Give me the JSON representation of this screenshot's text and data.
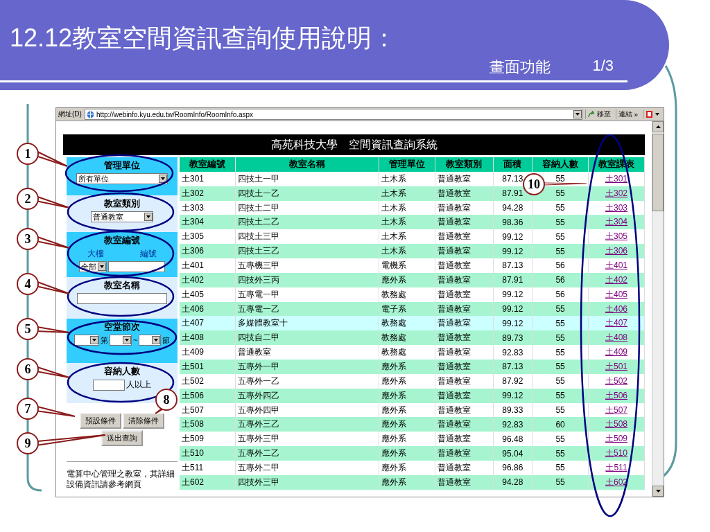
{
  "slide": {
    "title": "12.12教室空間資訊查詢使用說明：",
    "subtitle": "畫面功能",
    "page": "1/3"
  },
  "browser": {
    "address_label": "網址(D)",
    "url": "http://webinfo.kyu.edu.tw/RoomInfo/RoomInfo.aspx",
    "go": "移至",
    "links": "連結",
    "more": "»"
  },
  "page": {
    "header": "高苑科技大學　空間資訊查詢系統",
    "filters": [
      {
        "kind": "dropdown",
        "label": "管理單位",
        "value": "所有單位",
        "wide": true
      },
      {
        "kind": "dropdown",
        "label": "教室類別",
        "value": "普通教室",
        "wide": false
      },
      {
        "kind": "building",
        "label": "教室編號",
        "sublabels": [
          "大樓",
          "編號"
        ],
        "value": "全部"
      },
      {
        "kind": "text",
        "label": "教室名稱"
      },
      {
        "kind": "period",
        "label": "空堂節次",
        "from_text": "第",
        "to_text": "~",
        "end_text": "節"
      },
      {
        "kind": "count",
        "label": "容納人數",
        "suffix": "人以上"
      }
    ],
    "buttons": [
      "預設條件",
      "清除條件"
    ],
    "submit": "送出查詢",
    "note": "電算中心管理之教室，其詳細設備資訊請參考網頁",
    "table": {
      "columns": [
        "教室編號",
        "教室名稱",
        "管理單位",
        "教室類別",
        "面積",
        "容納人數",
        "教室課表"
      ],
      "rows": [
        {
          "code": "土301",
          "name": "四技土一甲",
          "unit": "土木系",
          "type": "普通教室",
          "area": "87.13",
          "capacity": "55",
          "schedule": "土301",
          "highlighted": false
        },
        {
          "code": "土302",
          "name": "四技土一乙",
          "unit": "土木系",
          "type": "普通教室",
          "area": "87.91",
          "capacity": "55",
          "schedule": "土302",
          "highlighted": false
        },
        {
          "code": "土303",
          "name": "四技土二甲",
          "unit": "土木系",
          "type": "普通教室",
          "area": "94.28",
          "capacity": "55",
          "schedule": "土303",
          "highlighted": false
        },
        {
          "code": "土304",
          "name": "四技土二乙",
          "unit": "土木系",
          "type": "普通教室",
          "area": "98.36",
          "capacity": "55",
          "schedule": "土304",
          "highlighted": false
        },
        {
          "code": "土305",
          "name": "四技土三甲",
          "unit": "土木系",
          "type": "普通教室",
          "area": "99.12",
          "capacity": "55",
          "schedule": "土305",
          "highlighted": false
        },
        {
          "code": "土306",
          "name": "四技土三乙",
          "unit": "土木系",
          "type": "普通教室",
          "area": "99.12",
          "capacity": "55",
          "schedule": "土306",
          "highlighted": false
        },
        {
          "code": "土401",
          "name": "五專機三甲",
          "unit": "電機系",
          "type": "普通教室",
          "area": "87.13",
          "capacity": "56",
          "schedule": "土401",
          "highlighted": false
        },
        {
          "code": "土402",
          "name": "四技外三丙",
          "unit": "應外系",
          "type": "普通教室",
          "area": "87.91",
          "capacity": "56",
          "schedule": "土402",
          "highlighted": false
        },
        {
          "code": "土405",
          "name": "五專電一甲",
          "unit": "教務處",
          "type": "普通教室",
          "area": "99.12",
          "capacity": "56",
          "schedule": "土405",
          "highlighted": false
        },
        {
          "code": "土406",
          "name": "五專電一乙",
          "unit": "電子系",
          "type": "普通教室",
          "area": "99.12",
          "capacity": "55",
          "schedule": "土406",
          "highlighted": false
        },
        {
          "code": "土407",
          "name": "多媒體教室十",
          "unit": "教務處",
          "type": "普通教室",
          "area": "99.12",
          "capacity": "55",
          "schedule": "土407",
          "highlighted": true
        },
        {
          "code": "土408",
          "name": "四技自二甲",
          "unit": "教務處",
          "type": "普通教室",
          "area": "89.73",
          "capacity": "55",
          "schedule": "土408",
          "highlighted": false
        },
        {
          "code": "土409",
          "name": "普通教室",
          "unit": "教務處",
          "type": "普通教室",
          "area": "92.83",
          "capacity": "55",
          "schedule": "土409",
          "highlighted": false
        },
        {
          "code": "土501",
          "name": "五專外一甲",
          "unit": "應外系",
          "type": "普通教室",
          "area": "87.13",
          "capacity": "55",
          "schedule": "土501",
          "highlighted": false
        },
        {
          "code": "土502",
          "name": "五專外一乙",
          "unit": "應外系",
          "type": "普通教室",
          "area": "87.92",
          "capacity": "55",
          "schedule": "土502",
          "highlighted": false
        },
        {
          "code": "土506",
          "name": "五專外四乙",
          "unit": "應外系",
          "type": "普通教室",
          "area": "99.12",
          "capacity": "55",
          "schedule": "土506",
          "highlighted": false
        },
        {
          "code": "土507",
          "name": "五專外四甲",
          "unit": "應外系",
          "type": "普通教室",
          "area": "89.33",
          "capacity": "55",
          "schedule": "土507",
          "highlighted": false
        },
        {
          "code": "土508",
          "name": "五專外三乙",
          "unit": "應外系",
          "type": "普通教室",
          "area": "92.83",
          "capacity": "60",
          "schedule": "土508",
          "highlighted": false
        },
        {
          "code": "土509",
          "name": "五專外三甲",
          "unit": "應外系",
          "type": "普通教室",
          "area": "96.48",
          "capacity": "55",
          "schedule": "土509",
          "highlighted": false
        },
        {
          "code": "土510",
          "name": "五專外二乙",
          "unit": "應外系",
          "type": "普通教室",
          "area": "95.04",
          "capacity": "55",
          "schedule": "土510",
          "highlighted": false
        },
        {
          "code": "土511",
          "name": "五專外二甲",
          "unit": "應外系",
          "type": "普通教室",
          "area": "96.86",
          "capacity": "55",
          "schedule": "土511",
          "highlighted": false
        },
        {
          "code": "土602",
          "name": "四技外三甲",
          "unit": "應外系",
          "type": "普通教室",
          "area": "94.28",
          "capacity": "55",
          "schedule": "土602",
          "highlighted": false
        }
      ]
    }
  },
  "callouts": [
    "1",
    "2",
    "3",
    "4",
    "5",
    "6",
    "7",
    "8",
    "9",
    "10"
  ]
}
